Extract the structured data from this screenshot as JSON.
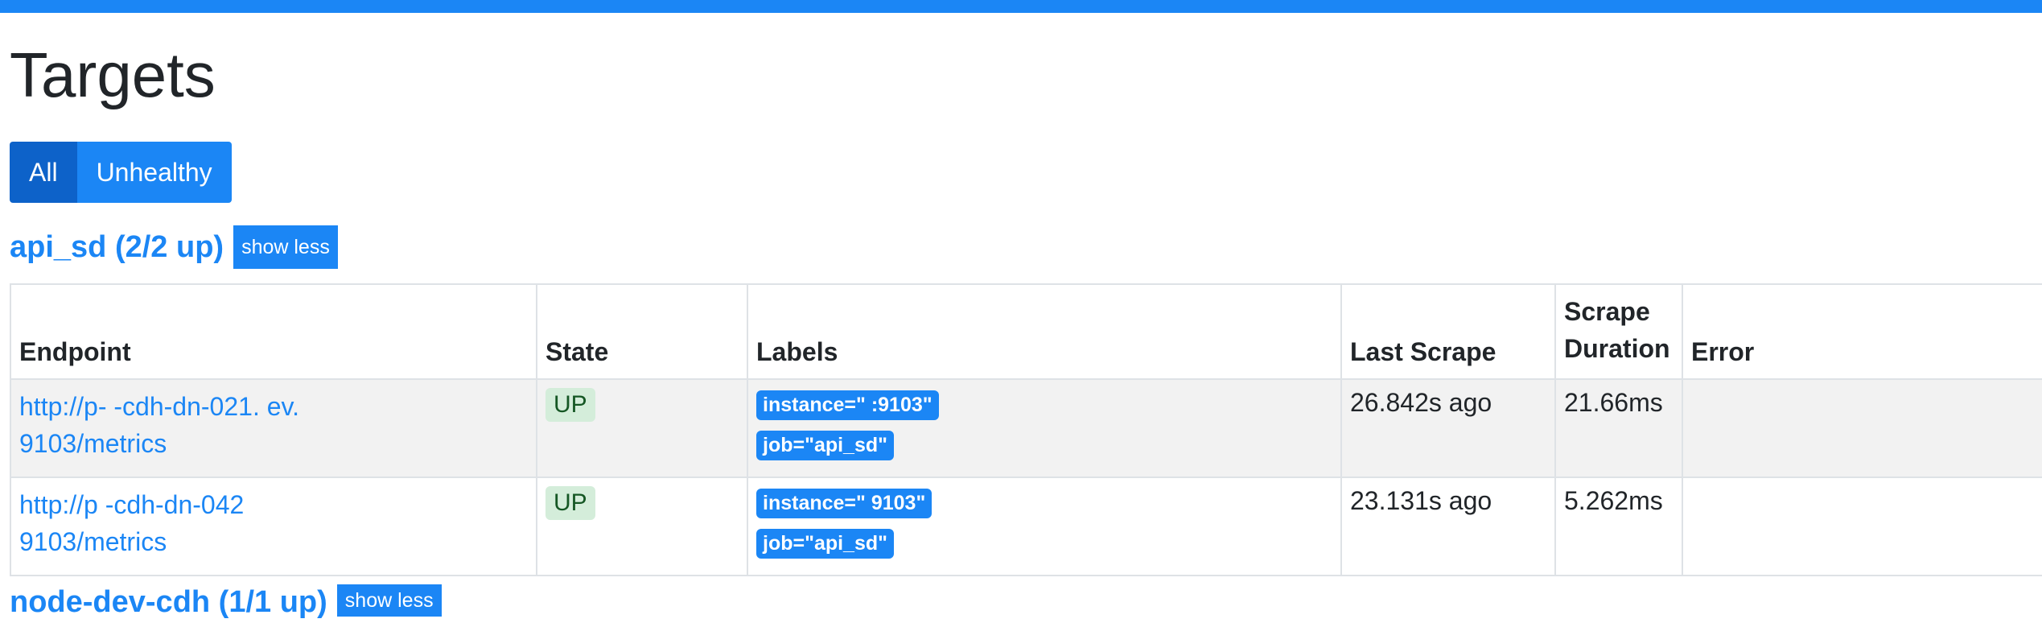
{
  "colors": {
    "accent": "#1b86f5",
    "accent_dark": "#0d62c9",
    "up_bg": "#d4edda",
    "up_text": "#155724"
  },
  "page": {
    "title": "Targets"
  },
  "filters": {
    "all": "All",
    "unhealthy": "Unhealthy"
  },
  "job": {
    "title": "api_sd (2/2 up)",
    "toggle": "show less",
    "columns": {
      "endpoint": "Endpoint",
      "state": "State",
      "labels": "Labels",
      "last_scrape": "Last Scrape",
      "scrape_duration": "Scrape Duration",
      "error": "Error"
    },
    "rows": [
      {
        "endpoint_line1": "http://p-        -cdh-dn-021.              ev.",
        "endpoint_line2": "    9103/metrics",
        "state": "UP",
        "label_instance": "instance=\"                                                          :9103\"",
        "label_job": "job=\"api_sd\"",
        "last_scrape": "26.842s ago",
        "scrape_duration": "21.66ms",
        "error": ""
      },
      {
        "endpoint_line1": "http://p             -cdh-dn-042",
        "endpoint_line2": "    9103/metrics",
        "state": "UP",
        "label_instance": "instance=\"                                                           9103\"",
        "label_job": "job=\"api_sd\"",
        "last_scrape": "23.131s ago",
        "scrape_duration": "5.262ms",
        "error": ""
      }
    ]
  },
  "next_job": {
    "title": "node-dev-cdh (1/1 up)",
    "toggle": "show less"
  }
}
